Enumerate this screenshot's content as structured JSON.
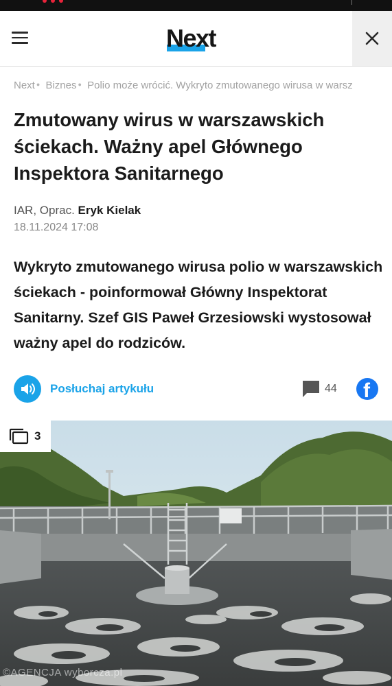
{
  "header": {
    "logo": "Next"
  },
  "breadcrumb": [
    "Next",
    "Biznes",
    "Polio może wrócić. Wykryto zmutowanego wirusa w warsz"
  ],
  "article": {
    "title": "Zmutowany wirus w warszawskich ściekach. Ważny apel Głównego Inspektora Sanitarnego",
    "author_prefix": "IAR, Oprac.",
    "author_name": "Eryk Kielak",
    "date": "18.11.2024 17:08",
    "lead": "Wykryto zmutowanego wirusa polio w warszawskich ściekach - poinformował Główny Inspektorat Sanitarny. Szef GIS Paweł Grzesiowski wystosował ważny apel do rodziców.",
    "listen_label": "Posłuchaj artykułu",
    "comments_count": "44",
    "gallery_count": "3",
    "photo_credit": "©AGENCJA wyborcza.pl"
  },
  "colors": {
    "accent": "#1aa3e8",
    "facebook": "#1877f2"
  },
  "icons": [
    "menu-icon",
    "close-icon",
    "speaker-icon",
    "comment-icon",
    "facebook-icon",
    "gallery-icon"
  ]
}
